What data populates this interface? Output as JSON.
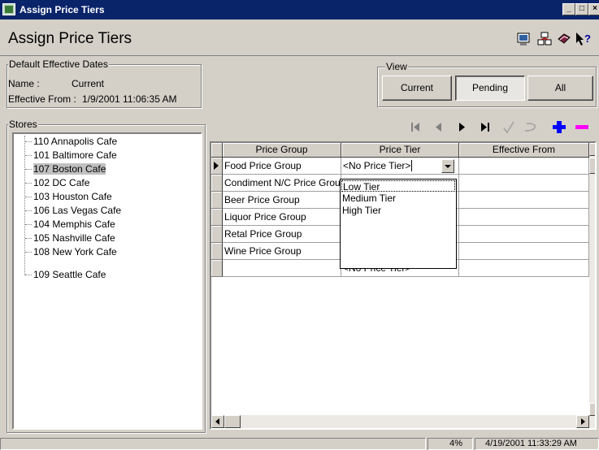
{
  "window": {
    "title": "Assign Price Tiers"
  },
  "header": {
    "title": "Assign Price Tiers",
    "icons": [
      "screen-icon",
      "sync-icon",
      "report-book-icon",
      "help-pointer-icon"
    ]
  },
  "defaults_group": {
    "label": "Default Effective Dates",
    "name_label": "Name :",
    "name_value": "Current",
    "effective_label": "Effective From :",
    "effective_value": "1/9/2001 11:06:35 AM"
  },
  "view_group": {
    "label": "View",
    "buttons": [
      {
        "label": "Current",
        "pressed": false
      },
      {
        "label": "Pending",
        "pressed": true
      },
      {
        "label": "All",
        "pressed": false
      }
    ]
  },
  "stores_group": {
    "label": "Stores",
    "items": [
      "110 Annapolis Cafe",
      "101 Baltimore Cafe",
      "107 Boston Cafe",
      "102 DC Cafe",
      "103 Houston Cafe",
      "106 Las Vegas Cafe",
      "104 Memphis Cafe",
      "105 Nashville Cafe",
      "108 New York Cafe",
      "109 Seattle Cafe"
    ],
    "selected": "107 Boston Cafe"
  },
  "navigator": {
    "icons": [
      "first-record-icon",
      "prior-record-icon",
      "next-record-icon",
      "last-record-icon",
      "post-check-icon",
      "cancel-edit-icon",
      "insert-plus-icon",
      "delete-minus-icon"
    ],
    "colors": {
      "plus": "#0000ff",
      "minus": "#ff00ff",
      "disabled": "#808080"
    }
  },
  "grid": {
    "columns": [
      "Price Group",
      "Price Tier",
      "Effective From"
    ],
    "rows": [
      {
        "group": "Food Price Group",
        "tier": "<No Price Tier>",
        "current": true
      },
      {
        "group": "Condiment N/C Price Group",
        "tier": ""
      },
      {
        "group": "Beer Price Group",
        "tier": ""
      },
      {
        "group": "Liquor Price Group",
        "tier": ""
      },
      {
        "group": "Retal Price Group",
        "tier": ""
      },
      {
        "group": "Wine Price Group",
        "tier": ""
      },
      {
        "group": "",
        "tier": "<No Price Tier>"
      }
    ]
  },
  "tier_dropdown": {
    "options": [
      "Low Tier",
      "Medium Tier",
      "High Tier"
    ],
    "highlighted": "Low Tier"
  },
  "statusbar": {
    "percent": "4%",
    "datetime": "4/19/2001 11:33:29 AM"
  }
}
